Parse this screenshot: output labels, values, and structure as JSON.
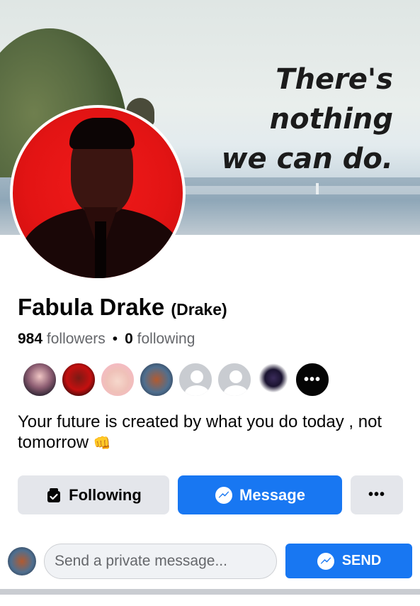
{
  "cover": {
    "caption_lines": [
      "There's",
      "nothing",
      "we can do."
    ]
  },
  "profile": {
    "name": "Fabula Drake",
    "alternate_name": "(Drake)",
    "followers_count": "984",
    "followers_label": "followers",
    "separator": "•",
    "following_count": "0",
    "following_label": "following",
    "bio_text": "Your future is created by what you do today , not tomorrow",
    "bio_emoji": "👊",
    "more_friends_glyph": "•••"
  },
  "actions": {
    "following_label": "Following",
    "message_label": "Message",
    "more_label": "•••"
  },
  "private_message": {
    "placeholder": "Send a private message...",
    "send_label": "SEND"
  },
  "colors": {
    "brand_blue": "#1877f2",
    "secondary_button": "#e4e6eb",
    "muted_text": "#65676b"
  },
  "icons": {
    "following": "following-check-icon",
    "message": "messenger-icon",
    "send": "messenger-icon",
    "more": "more-dots-icon"
  }
}
